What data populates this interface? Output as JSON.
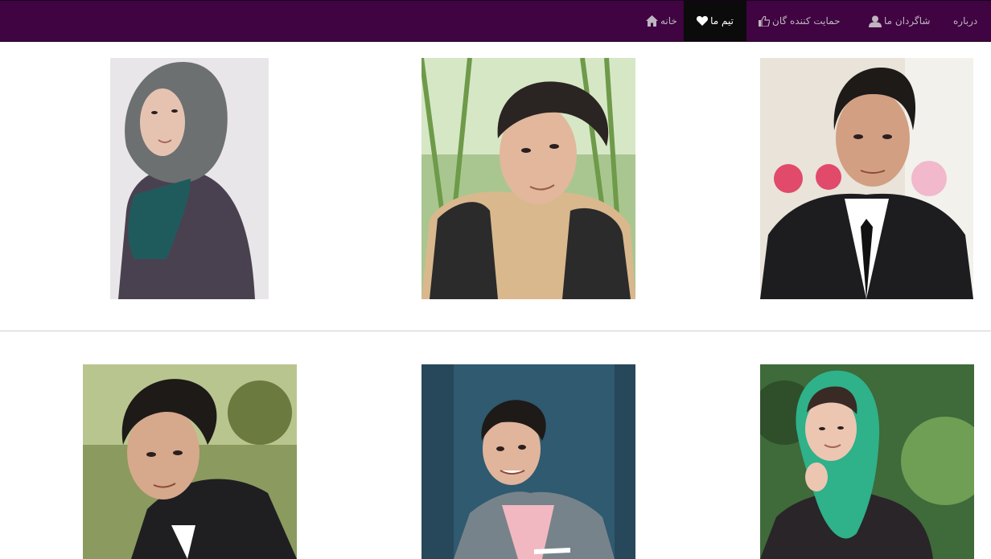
{
  "navbar": {
    "background": "#3f0441",
    "items": [
      {
        "label": "درباره",
        "icon": null,
        "active": false
      },
      {
        "label": "شاگردان  ما",
        "icon": "user-icon",
        "active": false
      },
      {
        "label": "حمایت  کننده  گان",
        "icon": "thumbs-up-icon",
        "active": false
      },
      {
        "label": "تیم  ما",
        "icon": "heart-icon",
        "active": true
      },
      {
        "label": "خانه",
        "icon": "home-icon",
        "active": false
      }
    ]
  },
  "team": {
    "members": [
      {
        "photo_alt": "team member photo 1"
      },
      {
        "photo_alt": "team member photo 2"
      },
      {
        "photo_alt": "team member photo 3"
      },
      {
        "photo_alt": "team member photo 4"
      },
      {
        "photo_alt": "team member photo 5"
      },
      {
        "photo_alt": "team member photo 6"
      }
    ]
  }
}
